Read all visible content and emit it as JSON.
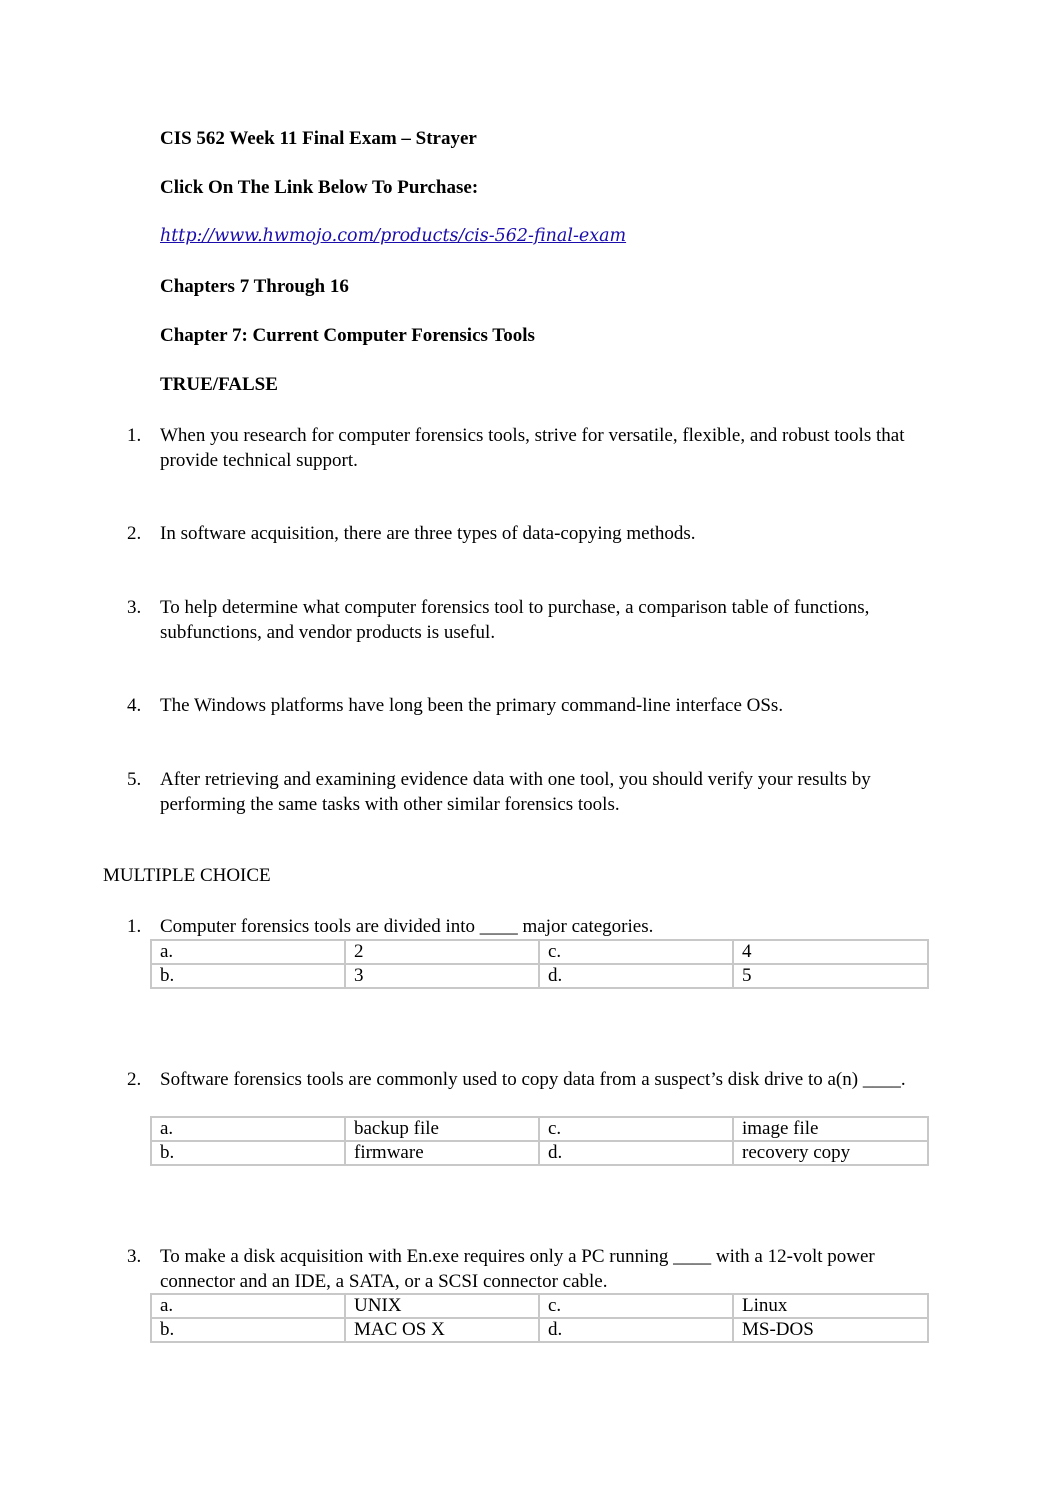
{
  "header": {
    "title": "CIS 562 Week 11 Final Exam – Strayer",
    "purchase_prompt": "Click On The Link Below To Purchase:",
    "link": "http://www.hwmojo.com/products/cis-562-final-exam",
    "chapters": "Chapters 7 Through 16",
    "chapter_title": "Chapter 7: Current Computer Forensics Tools",
    "tf_heading": "TRUE/FALSE"
  },
  "true_false": [
    {
      "num": "1.",
      "text": "When you research for computer forensics tools, strive for versatile, flexible, and robust tools that provide technical support."
    },
    {
      "num": "2.",
      "text": "In software acquisition, there are three types of data-copying methods."
    },
    {
      "num": "3.",
      "text": "To help determine what computer forensics tool to purchase, a comparison table of functions, subfunctions, and vendor products is useful."
    },
    {
      "num": "4.",
      "text": "The Windows platforms have long been the primary command-line interface OSs."
    },
    {
      "num": "5.",
      "text": "After retrieving and examining evidence data with one tool, you should verify your results by performing the same tasks with other similar forensics tools."
    }
  ],
  "mc_heading": "MULTIPLE CHOICE",
  "multiple_choice": [
    {
      "num": "1.",
      "text": "Computer forensics tools are divided into ____ major categories.",
      "options": [
        [
          "a.",
          "2",
          "c.",
          "4"
        ],
        [
          "b.",
          "3",
          "d.",
          "5"
        ]
      ]
    },
    {
      "num": "2.",
      "text": "Software forensics tools are commonly used to copy data from a suspect’s disk drive to a(n) ____.",
      "options": [
        [
          "a.",
          "backup file",
          "c.",
          "image file"
        ],
        [
          "b.",
          "firmware",
          "d.",
          "recovery copy"
        ]
      ]
    },
    {
      "num": "3.",
      "text": "To make a disk acquisition with En.exe requires only a PC running ____ with a 12-volt power connector and an IDE, a SATA, or a SCSI connector cable.",
      "options": [
        [
          "a.",
          "UNIX",
          "c.",
          "Linux"
        ],
        [
          "b.",
          "MAC OS X",
          "d.",
          "MS-DOS"
        ]
      ]
    }
  ]
}
